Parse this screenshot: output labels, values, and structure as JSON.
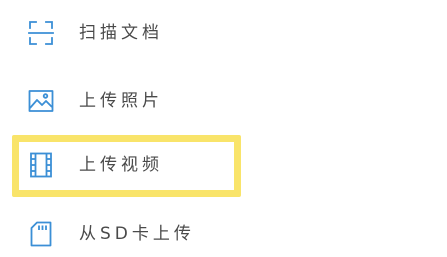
{
  "menu": {
    "items": [
      {
        "label": "扫描文档",
        "icon": "scan-icon"
      },
      {
        "label": "上传照片",
        "icon": "image-icon"
      },
      {
        "label": "上传视频",
        "icon": "video-icon"
      },
      {
        "label": "从SD卡上传",
        "icon": "sd-card-icon"
      }
    ]
  },
  "colors": {
    "icon": "#3b8fd6",
    "text": "#4a4a4a",
    "highlight": "#f9e46a"
  }
}
